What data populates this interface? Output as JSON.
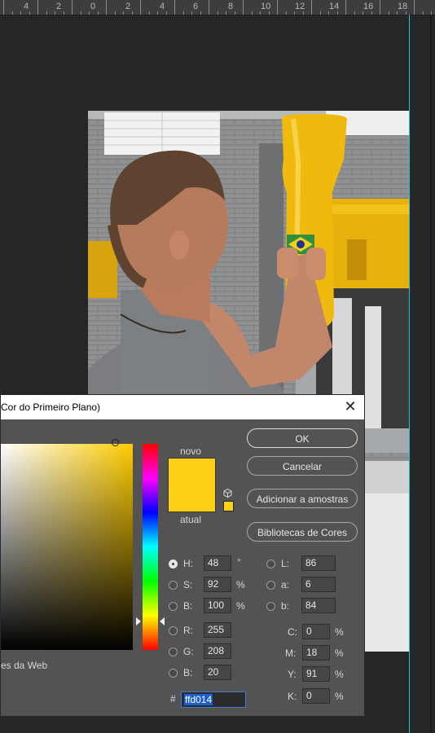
{
  "ruler": {
    "labels": [
      "4",
      "2",
      "0",
      "2",
      "4",
      "6",
      "8",
      "10",
      "12",
      "14",
      "16",
      "18"
    ]
  },
  "dialog": {
    "title": "Cor do Primeiro Plano)",
    "close_glyph": "✕",
    "labels": {
      "novo": "novo",
      "atual": "atual"
    },
    "web_only_label": "es da Web",
    "current_color": "#ffd014",
    "buttons": {
      "ok": "OK",
      "cancel": "Cancelar",
      "add_swatch": "Adicionar a amostras",
      "libraries": "Bibliotecas de Cores"
    },
    "hsb": {
      "h_label": "H:",
      "h_value": "48",
      "h_unit": "°",
      "s_label": "S:",
      "s_value": "92",
      "s_unit": "%",
      "b_label": "B:",
      "b_value": "100",
      "b_unit": "%"
    },
    "rgb": {
      "r_label": "R:",
      "r_value": "255",
      "g_label": "G:",
      "g_value": "208",
      "b_label": "B:",
      "b_value": "20"
    },
    "lab": {
      "l_label": "L:",
      "l_value": "86",
      "a_label": "a:",
      "a_value": "6",
      "b_label": "b:",
      "b_value": "84"
    },
    "cmyk": {
      "c_label": "C:",
      "c_value": "0",
      "c_unit": "%",
      "m_label": "M:",
      "m_value": "18",
      "m_unit": "%",
      "y_label": "Y:",
      "y_value": "91",
      "y_unit": "%",
      "k_label": "K:",
      "k_value": "0",
      "k_unit": "%"
    },
    "hex": {
      "prefix": "#",
      "value": "ffd014"
    }
  },
  "colors": {
    "selected": "#ffd014",
    "guide": "#16c7e8",
    "dialog_bg": "#535353"
  }
}
